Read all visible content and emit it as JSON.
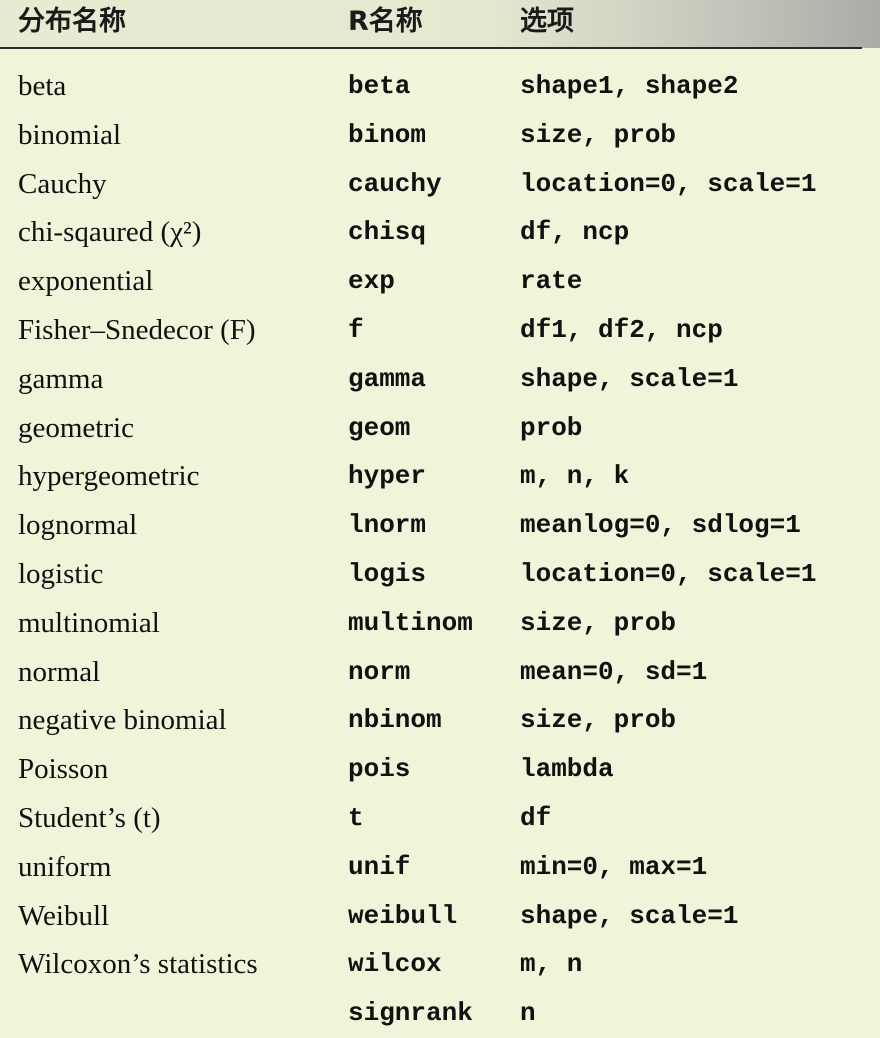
{
  "table": {
    "headers": [
      "分布名称",
      "R名称",
      "选项"
    ],
    "rows": [
      [
        "beta",
        "beta",
        "shape1, shape2"
      ],
      [
        "binomial",
        "binom",
        "size, prob"
      ],
      [
        "Cauchy",
        "cauchy",
        "location=0, scale=1"
      ],
      [
        "chi-sqaured (χ²)",
        "chisq",
        "df, ncp"
      ],
      [
        "exponential",
        "exp",
        "rate"
      ],
      [
        "Fisher–Snedecor (F)",
        "f",
        "df1, df2, ncp"
      ],
      [
        "gamma",
        "gamma",
        "shape, scale=1"
      ],
      [
        "geometric",
        "geom",
        "prob"
      ],
      [
        "hypergeometric",
        "hyper",
        "m, n, k"
      ],
      [
        "lognormal",
        "lnorm",
        "meanlog=0, sdlog=1"
      ],
      [
        "logistic",
        "logis",
        "location=0, scale=1"
      ],
      [
        "multinomial",
        "multinom",
        "size, prob"
      ],
      [
        "normal",
        "norm",
        "mean=0, sd=1"
      ],
      [
        "negative binomial",
        "nbinom",
        "size, prob"
      ],
      [
        "Poisson",
        "pois",
        "lambda"
      ],
      [
        "Student’s (t)",
        "t",
        "df"
      ],
      [
        "uniform",
        "unif",
        "min=0, max=1"
      ],
      [
        "Weibull",
        "weibull",
        "shape, scale=1"
      ],
      [
        "Wilcoxon’s statistics",
        "wilcox",
        "m, n"
      ],
      [
        "",
        "signrank",
        "n"
      ]
    ]
  }
}
